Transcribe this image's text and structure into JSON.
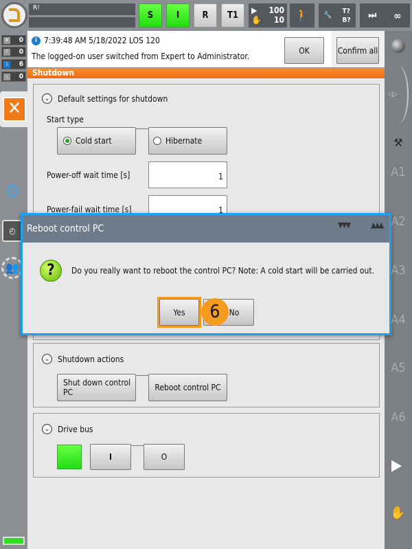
{
  "topbar": {
    "status_text": "R!",
    "s": "S",
    "i": "I",
    "r": "R",
    "t1": "T1",
    "override_prog": "100",
    "override_jog": "10",
    "tool": "T?",
    "base": "B?",
    "increment": "∞"
  },
  "left": {
    "counters": [
      {
        "icon": "error-icon",
        "value": "0"
      },
      {
        "icon": "warning-icon",
        "value": "0"
      },
      {
        "icon": "info-icon",
        "value": "6"
      },
      {
        "icon": "wait-icon",
        "value": "0"
      }
    ]
  },
  "message": {
    "header": "7:39:48 AM 5/18/2022 LOS 120",
    "text": "The logged-on user switched from Expert to Administrator.",
    "ok": "OK",
    "confirm_all": "Confirm all"
  },
  "window_title": "Shutdown",
  "defaults": {
    "title": "Default settings for shutdown",
    "start_type": "Start type",
    "cold_start": "Cold start",
    "hibernate": "Hibernate",
    "selected": "Cold start",
    "poweroff_label": "Power-off wait time [s]",
    "poweroff_value": "1",
    "powerfail_label": "Power-fail wait time [s]",
    "powerfail_value": "1"
  },
  "actions": {
    "title": "Shutdown actions",
    "shutdown": "Shut down control PC",
    "reboot": "Reboot control PC"
  },
  "drivebus": {
    "title": "Drive bus",
    "on": "I",
    "off": "O",
    "state_color": "#33ee22"
  },
  "dialog": {
    "title": "Reboot control PC",
    "message": "Do you really want to reboot the control PC? Note: A cold start will be carried out.",
    "yes": "Yes",
    "no": "No",
    "step_badge": "6"
  },
  "right": {
    "axes": [
      "A1",
      "A2",
      "A3",
      "A4",
      "A5",
      "A6"
    ]
  },
  "colors": {
    "accent": "#f07a1a",
    "dialog_border": "#1ea0f0",
    "badge": "#f39a1f"
  }
}
